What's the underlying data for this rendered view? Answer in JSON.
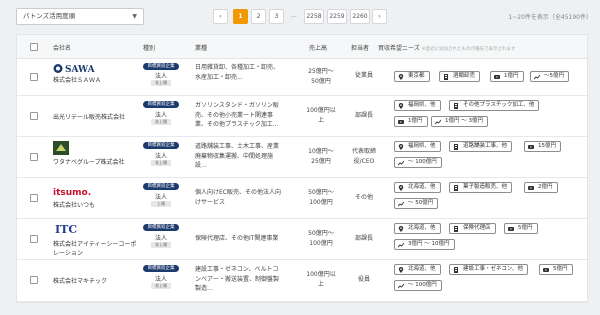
{
  "toolbar": {
    "sort_label": "パトンズ活用度順",
    "range_text": "1~20件を表示（全45190件）"
  },
  "pagination": {
    "prev": "‹",
    "pages": [
      "1",
      "2",
      "3"
    ],
    "dots": "...",
    "last_pages": [
      "2258",
      "2259",
      "2260"
    ],
    "next": "›",
    "active": "1"
  },
  "table": {
    "headers": {
      "company": "会社名",
      "type": "種別",
      "business": "業種",
      "sales": "売上高",
      "person": "担当者",
      "needs": "買収希望ニーズ",
      "needs_note": "※直近に追加されたものが優先で表示されます"
    },
    "rows": [
      {
        "company": "株式会社ＳＡＷＡ",
        "logo_text": "SAWA",
        "badge": "目標買収企業",
        "corp": "法人",
        "listed": "非上場",
        "business": [
          "日用雑貨卸、各種加工・卸売、",
          "水産加工・卸売..."
        ],
        "sales": [
          "25億円～",
          "50億円"
        ],
        "person": [
          "従業員"
        ],
        "chips": [
          {
            "icon": "pin-icon",
            "text": "東京都"
          },
          {
            "icon": "building-icon",
            "text": "酒類卸売"
          },
          {
            "icon": "video-icon",
            "text": "1億円"
          },
          {
            "icon": "trend-icon",
            "text": "～5億円"
          }
        ]
      },
      {
        "company": "出光リテール販売株式会社",
        "logo_text": "",
        "badge": "目標買収企業",
        "corp": "法人",
        "listed": "非上場",
        "business": [
          "ガソリンスタンド・ガソリン販",
          "売、その他小売業ート関連事",
          "業、その他プラスチック加工..."
        ],
        "sales": [
          "100億円以",
          "上"
        ],
        "person": [
          "部課長"
        ],
        "chips": [
          {
            "icon": "pin-icon",
            "text": "福岡県、他"
          },
          {
            "icon": "building-icon",
            "text": "その他プラスチック加工、他"
          },
          {
            "icon": "video-icon",
            "text": "1億円"
          },
          {
            "icon": "trend-icon",
            "text": "1億円 ～ 3億円"
          }
        ]
      },
      {
        "company": "ワタナベグループ株式会社",
        "logo_text": "",
        "badge": "目標買収企業",
        "corp": "法人",
        "listed": "非上場",
        "business": [
          "道路舗装工事、土木工事、産業",
          "廃棄物収集運搬、中間処理施",
          "設..."
        ],
        "sales": [
          "10億円～",
          "25億円"
        ],
        "person": [
          "代表取締",
          "役/CEO"
        ],
        "chips": [
          {
            "icon": "pin-icon",
            "text": "福岡県、他"
          },
          {
            "icon": "building-icon",
            "text": "道路舗装工事、他"
          },
          {
            "icon": "video-icon",
            "text": "15億円"
          },
          {
            "icon": "trend-icon",
            "text": "～ 100億円"
          }
        ]
      },
      {
        "company": "株式会社いつも",
        "logo_text": "itsumo.",
        "badge": "目標買収企業",
        "corp": "法人",
        "listed": "上場",
        "business": [
          "個人向けEC販売、その他法人向",
          "けサービス"
        ],
        "sales": [
          "50億円～",
          "100億円"
        ],
        "person": [
          "その他"
        ],
        "chips": [
          {
            "icon": "pin-icon",
            "text": "北海道、他"
          },
          {
            "icon": "building-icon",
            "text": "菓子製造販売、他"
          },
          {
            "icon": "video-icon",
            "text": "2億円"
          },
          {
            "icon": "trend-icon",
            "text": "～ 50億円"
          }
        ]
      },
      {
        "company": "株式会社アイティーシーコーポ",
        "company2": "レーション",
        "logo_text": "ITC",
        "badge": "目標買収企業",
        "corp": "法人",
        "listed": "非上場",
        "business": [
          "保険代理店、その他IT関連事業"
        ],
        "sales": [
          "50億円～",
          "100億円"
        ],
        "person": [
          "部課長"
        ],
        "chips": [
          {
            "icon": "pin-icon",
            "text": "北海道、他"
          },
          {
            "icon": "building-icon",
            "text": "保険代理店"
          },
          {
            "icon": "video-icon",
            "text": "5億円"
          },
          {
            "icon": "trend-icon",
            "text": "3億円 ～ 10億円"
          }
        ]
      },
      {
        "company": "株式会社マキチック",
        "logo_text": "",
        "badge": "目標買収企業",
        "corp": "法人",
        "listed": "非上場",
        "business": [
          "建設工事・ゼネコン、ベルトコ",
          "ンベアー・搬送装置、制御盤製",
          "製造..."
        ],
        "sales": [
          "100億円以",
          "上"
        ],
        "person": [
          "役員"
        ],
        "chips": [
          {
            "icon": "pin-icon",
            "text": "北海道、他"
          },
          {
            "icon": "building-icon",
            "text": "建設工事・ゼネコン、他"
          },
          {
            "icon": "video-icon",
            "text": "5億円"
          },
          {
            "icon": "trend-icon",
            "text": "～ 100億円"
          }
        ]
      }
    ]
  }
}
